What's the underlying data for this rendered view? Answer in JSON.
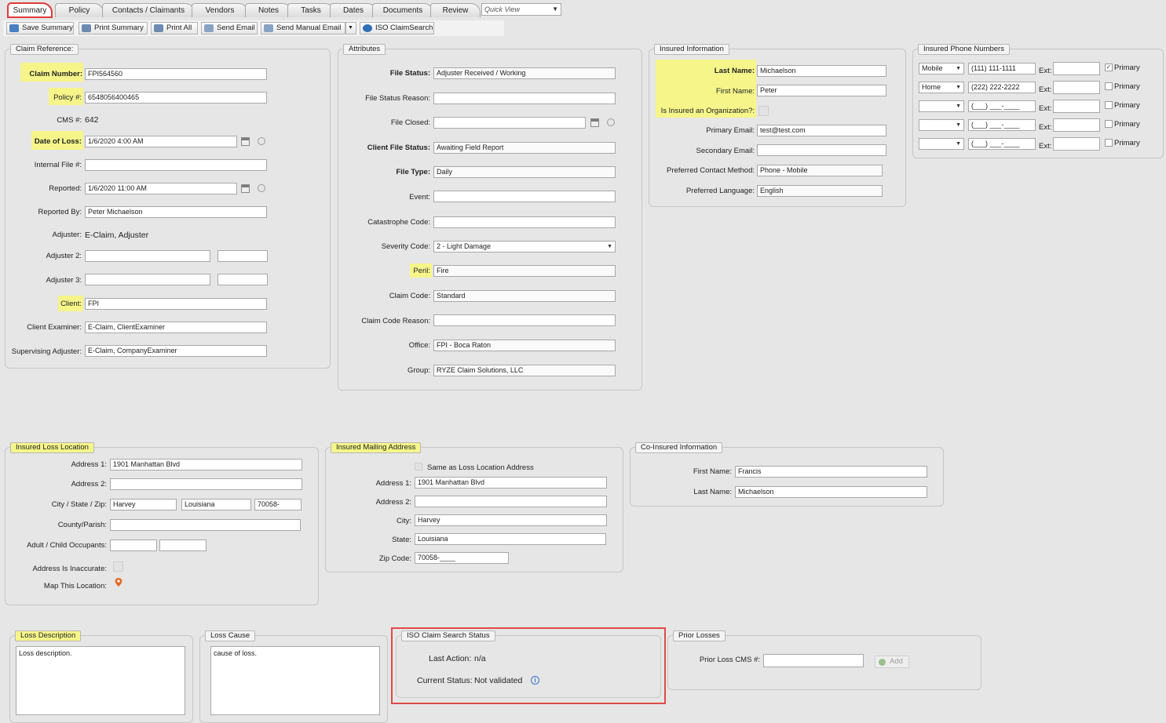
{
  "tabs": [
    "Summary",
    "Policy",
    "Contacts / Claimants",
    "Vendors",
    "Notes",
    "Tasks",
    "Dates",
    "Documents",
    "Review"
  ],
  "quick_view": {
    "placeholder": "Quick View"
  },
  "toolbar": {
    "save_summary": "Save Summary",
    "print_summary": "Print Summary",
    "print_all": "Print All",
    "send_email": "Send Email",
    "send_manual_email": "Send Manual Email",
    "iso_claimsearch": "ISO ClaimSearch"
  },
  "claim_reference": {
    "legend": "Claim Reference:",
    "claim_number_label": "Claim Number:",
    "claim_number": "FPI564560",
    "policy_label": "Policy #:",
    "policy": "6548056400465",
    "cms_label": "CMS #:",
    "cms": "642",
    "date_of_loss_label": "Date of Loss:",
    "date_of_loss": "1/6/2020 4:00 AM",
    "internal_file_label": "Internal File #:",
    "internal_file": "",
    "reported_label": "Reported:",
    "reported": "1/6/2020 11:00 AM",
    "reported_by_label": "Reported By:",
    "reported_by": "Peter Michaelson",
    "adjuster_label": "Adjuster:",
    "adjuster": "E-Claim, Adjuster",
    "adjuster2_label": "Adjuster 2:",
    "adjuster3_label": "Adjuster 3:",
    "client_label": "Client:",
    "client": "FPI",
    "client_examiner_label": "Client Examiner:",
    "client_examiner": "E-Claim, ClientExaminer",
    "supervising_adjuster_label": "Supervising Adjuster:",
    "supervising_adjuster": "E-Claim, CompanyExaminer"
  },
  "attributes": {
    "legend": "Attributes",
    "file_status_label": "File Status:",
    "file_status": "Adjuster Received / Working",
    "file_status_reason_label": "File Status Reason:",
    "file_status_reason": "",
    "file_closed_label": "File Closed:",
    "file_closed": "",
    "client_file_status_label": "Client File Status:",
    "client_file_status": "Awaiting Field Report",
    "file_type_label": "File Type:",
    "file_type": "Daily",
    "event_label": "Event:",
    "event": "",
    "catastrophe_code_label": "Catastrophe Code:",
    "catastrophe_code": "",
    "severity_code_label": "Severity Code:",
    "severity_code": "2 - Light Damage",
    "peril_label": "Peril:",
    "peril": "Fire",
    "claim_code_label": "Claim Code:",
    "claim_code": "Standard",
    "claim_code_reason_label": "Claim Code Reason:",
    "claim_code_reason": "",
    "office_label": "Office:",
    "office": "FPI - Boca Raton",
    "group_label": "Group:",
    "group": "RYZE Claim Solutions, LLC"
  },
  "insured_information": {
    "legend": "Insured Information",
    "last_name_label": "Last Name:",
    "last_name": "Michaelson",
    "first_name_label": "First Name:",
    "first_name": "Peter",
    "is_org_label": "Is Insured an Organization?:",
    "primary_email_label": "Primary Email:",
    "primary_email": "test@test.com",
    "secondary_email_label": "Secondary Email:",
    "secondary_email": "",
    "preferred_contact_label": "Preferred Contact Method:",
    "preferred_contact": "Phone - Mobile",
    "preferred_language_label": "Preferred Language:",
    "preferred_language": "English"
  },
  "insured_phones": {
    "legend": "Insured Phone Numbers",
    "ext_label": "Ext:",
    "primary_label": "Primary",
    "rows": [
      {
        "type": "Mobile",
        "number": "(111) 111-1111",
        "primary": true
      },
      {
        "type": "Home",
        "number": "(222) 222-2222",
        "primary": false
      },
      {
        "type": "",
        "number": "(___) ___-____",
        "primary": false
      },
      {
        "type": "",
        "number": "(___) ___-____",
        "primary": false
      },
      {
        "type": "",
        "number": "(___) ___-____",
        "primary": false
      }
    ]
  },
  "loss_location": {
    "legend": "Insured Loss Location",
    "address1_label": "Address 1:",
    "address1": "1901 Manhattan Blvd",
    "address2_label": "Address 2:",
    "address2": "",
    "city_state_zip_label": "City / State / Zip:",
    "city": "Harvey",
    "state": "Louisiana",
    "zip": "70058-",
    "county_label": "County/Parish:",
    "county": "",
    "occupants_label": "Adult / Child Occupants:",
    "inaccurate_label": "Address Is Inaccurate:",
    "map_label": "Map This Location:"
  },
  "mailing_address": {
    "legend": "Insured Mailing Address",
    "same_as_label": "Same as Loss Location Address",
    "address1_label": "Address 1:",
    "address1": "1901 Manhattan Blvd",
    "address2_label": "Address 2:",
    "address2": "",
    "city_label": "City:",
    "city": "Harvey",
    "state_label": "State:",
    "state": "Louisiana",
    "zip_label": "Zip Code:",
    "zip": "70058-____"
  },
  "co_insured": {
    "legend": "Co-Insured Information",
    "first_name_label": "First Name:",
    "first_name": "Francis",
    "last_name_label": "Last Name:",
    "last_name": "Michaelson"
  },
  "loss_description": {
    "legend": "Loss Description",
    "text": "Loss description."
  },
  "loss_cause": {
    "legend": "Loss Cause",
    "text": "cause of loss."
  },
  "iso_status": {
    "legend": "ISO Claim Search Status",
    "last_action_label": "Last Action:",
    "last_action": "n/a",
    "current_status_label": "Current Status:",
    "current_status": "Not validated"
  },
  "prior_losses": {
    "legend": "Prior Losses",
    "prior_cms_label": "Prior Loss CMS #:",
    "prior_cms": "",
    "add_label": "Add"
  },
  "colors": {
    "highlight": "#f5f58a",
    "callout": "#e04a4a"
  }
}
